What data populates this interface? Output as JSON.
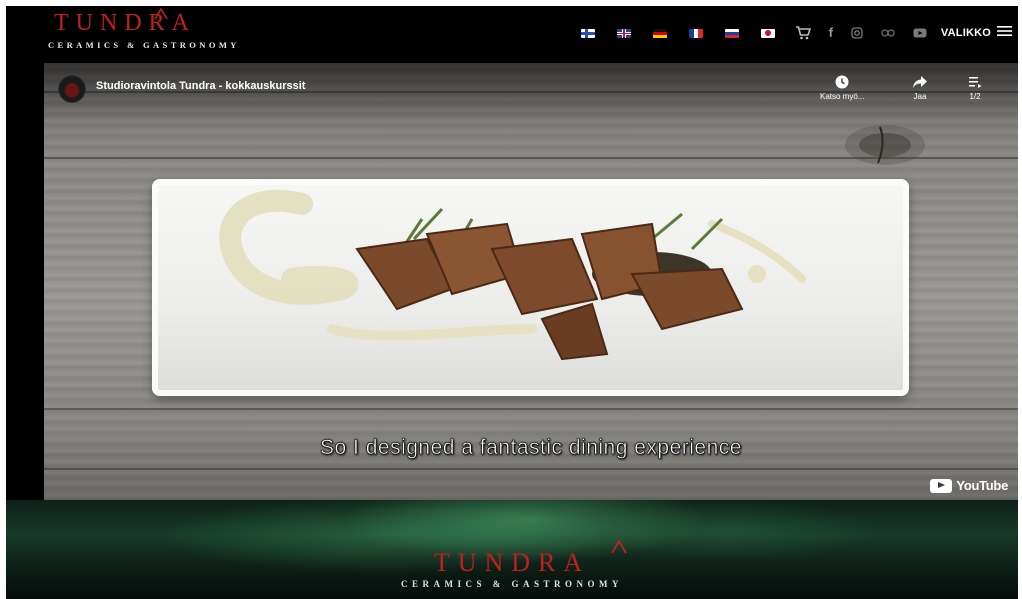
{
  "header": {
    "logo": {
      "word": "TUNDRA",
      "tagline": "CERAMICS & GASTRONOMY",
      "color": "#c0201c"
    },
    "languages": [
      {
        "icon": "flag-fi-icon"
      },
      {
        "icon": "flag-gb-icon"
      },
      {
        "icon": "flag-de-icon"
      },
      {
        "icon": "flag-fr-icon"
      },
      {
        "icon": "flag-ru-icon"
      },
      {
        "icon": "flag-jp-icon"
      }
    ],
    "icons": [
      "cart-icon",
      "facebook-icon",
      "instagram-icon",
      "tripadvisor-icon",
      "youtube-icon"
    ],
    "menu_label": "VALIKKO"
  },
  "video": {
    "channel_title": "Studioravintola Tundra - kokkauskurssit",
    "watch_later_label": "Katso myö...",
    "share_label": "Jaa",
    "playlist_label": "1/2",
    "subtitle": "So I designed a fantastic dining experience",
    "brand_label": "YouTube"
  },
  "banner": {
    "word": "TUNDRA",
    "tagline": "CERAMICS & GASTRONOMY"
  }
}
